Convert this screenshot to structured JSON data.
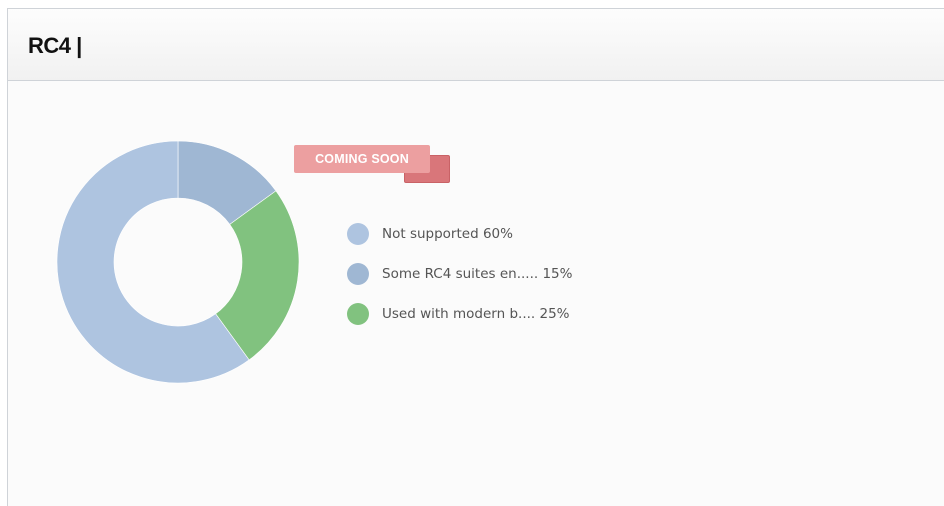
{
  "panel": {
    "title": "RC4 |",
    "badge": "COMING SOON"
  },
  "colors": {
    "not_supported": "#aec4e0",
    "some_rc4": "#9fb7d3",
    "modern": "#81c27f",
    "badge_front": "#ec9fa0",
    "badge_back": "#d9767a"
  },
  "chart_data": {
    "type": "pie",
    "variant": "donut",
    "title": "",
    "slices": [
      {
        "label": "Not supported",
        "value": 60,
        "color": "#aec4e0",
        "legend": "Not supported 60%"
      },
      {
        "label": "Some RC4 suites en.....",
        "value": 15,
        "color": "#9fb7d3",
        "legend": "Some RC4 suites en..... 15%"
      },
      {
        "label": "Used with modern b....",
        "value": 25,
        "color": "#81c27f",
        "legend": "Used with modern b.... 25%"
      }
    ],
    "legend_position": "right"
  }
}
